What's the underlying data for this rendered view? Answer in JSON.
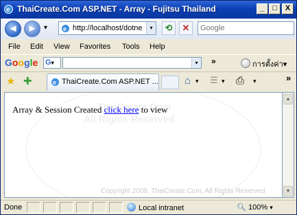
{
  "window": {
    "title": "ThaiCreate.Com ASP.NET - Array - Fujitsu Thailand",
    "minimize_label": "_",
    "maximize_label": "□",
    "close_label": "X"
  },
  "address": {
    "back_glyph": "◄",
    "forward_glyph": "►",
    "dropdown_glyph": "▾",
    "url": "http://localhost/dotne",
    "refresh_glyph": "⟲",
    "stop_glyph": "✕",
    "search_placeholder": "Google"
  },
  "menu": {
    "items": [
      "File",
      "Edit",
      "View",
      "Favorites",
      "Tools",
      "Help"
    ]
  },
  "google_bar": {
    "logo": "Google",
    "engine_glyph": "G",
    "chevron": "»",
    "settings_label": "การตั้งค่า▾"
  },
  "tabs": {
    "active_label": "ThaiCreate.Com ASP.NET ...",
    "chevron": "»",
    "home_glyph": "⌂",
    "rss_glyph": "☰",
    "print_glyph": "⎙",
    "caret": "▾",
    "star_glyph": "★",
    "add_fav_glyph": "✚"
  },
  "page": {
    "text_before": "Array & Session Created ",
    "link_text": "click here",
    "text_after": " to view",
    "watermark_line1": "ThaiCreate.Com",
    "watermark_line2": "All Rights Reserved",
    "copyright": "Copyright 2009, ThaiCreate.Com, All Rights Reserved"
  },
  "status": {
    "left": "Done",
    "zone": "Local intranet",
    "zoom": "100%",
    "zoom_caret": "▾"
  },
  "colors": {
    "titlebar": "#0b3fb4",
    "link": "#0000ee"
  }
}
